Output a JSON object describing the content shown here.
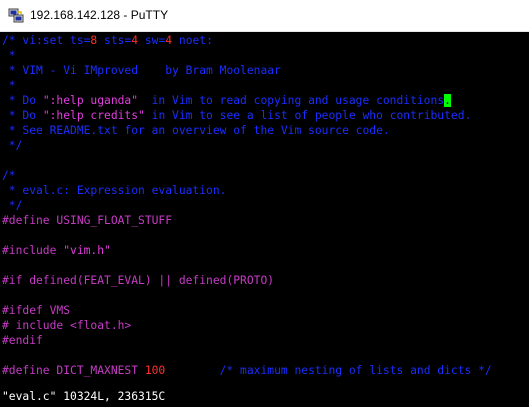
{
  "window": {
    "title": "192.168.142.128 - PuTTY",
    "icon": "putty-icon"
  },
  "colors": {
    "comment": "#1a2eff",
    "number": "#ff3030",
    "string": "#e23dde",
    "preproc": "#c63bc6",
    "cursor": "#00ff00",
    "status": "#ffffff",
    "background": "#000000"
  },
  "editor": {
    "lines": [
      [
        {
          "t": "/* vi:set ts=",
          "c": "comment"
        },
        {
          "t": "8",
          "c": "num"
        },
        {
          "t": " sts=",
          "c": "comment"
        },
        {
          "t": "4",
          "c": "num"
        },
        {
          "t": " sw=",
          "c": "comment"
        },
        {
          "t": "4",
          "c": "num"
        },
        {
          "t": " noet:",
          "c": "comment"
        }
      ],
      [
        {
          "t": " *",
          "c": "comment"
        }
      ],
      [
        {
          "t": " * VIM - Vi IMproved    by Bram Moolenaar",
          "c": "comment"
        }
      ],
      [
        {
          "t": " *",
          "c": "comment"
        }
      ],
      [
        {
          "t": " * Do ",
          "c": "comment"
        },
        {
          "t": "\":help uganda\"",
          "c": "str"
        },
        {
          "t": "  in Vim to read copying and usage conditions",
          "c": "comment"
        },
        {
          "t": ".",
          "c": "cursor"
        }
      ],
      [
        {
          "t": " * Do ",
          "c": "comment"
        },
        {
          "t": "\":help credits\"",
          "c": "str"
        },
        {
          "t": " in Vim to see a list of people who contributed.",
          "c": "comment"
        }
      ],
      [
        {
          "t": " * See README.txt for an overview of the Vim source code.",
          "c": "comment"
        }
      ],
      [
        {
          "t": " */",
          "c": "comment"
        }
      ],
      [],
      [
        {
          "t": "/*",
          "c": "comment"
        }
      ],
      [
        {
          "t": " * eval.c: Expression evaluation.",
          "c": "comment"
        }
      ],
      [
        {
          "t": " */",
          "c": "comment"
        }
      ],
      [
        {
          "t": "#define USING_FLOAT_STUFF",
          "c": "pre"
        }
      ],
      [],
      [
        {
          "t": "#include ",
          "c": "pre"
        },
        {
          "t": "\"vim.h\"",
          "c": "str"
        }
      ],
      [],
      [
        {
          "t": "#if defined(FEAT_EVAL) || defined(PROTO)",
          "c": "pre"
        }
      ],
      [],
      [
        {
          "t": "#ifdef VMS",
          "c": "pre"
        }
      ],
      [
        {
          "t": "# include <float.h>",
          "c": "pre"
        }
      ],
      [
        {
          "t": "#endif",
          "c": "pre"
        }
      ],
      [],
      [
        {
          "t": "#define DICT_MAXNEST ",
          "c": "pre"
        },
        {
          "t": "100",
          "c": "num"
        },
        {
          "t": "        ",
          "c": "pre"
        },
        {
          "t": "/* maximum nesting of lists and dicts */",
          "c": "comment"
        }
      ]
    ],
    "status_line": "\"eval.c\" 10324L, 236315C"
  }
}
